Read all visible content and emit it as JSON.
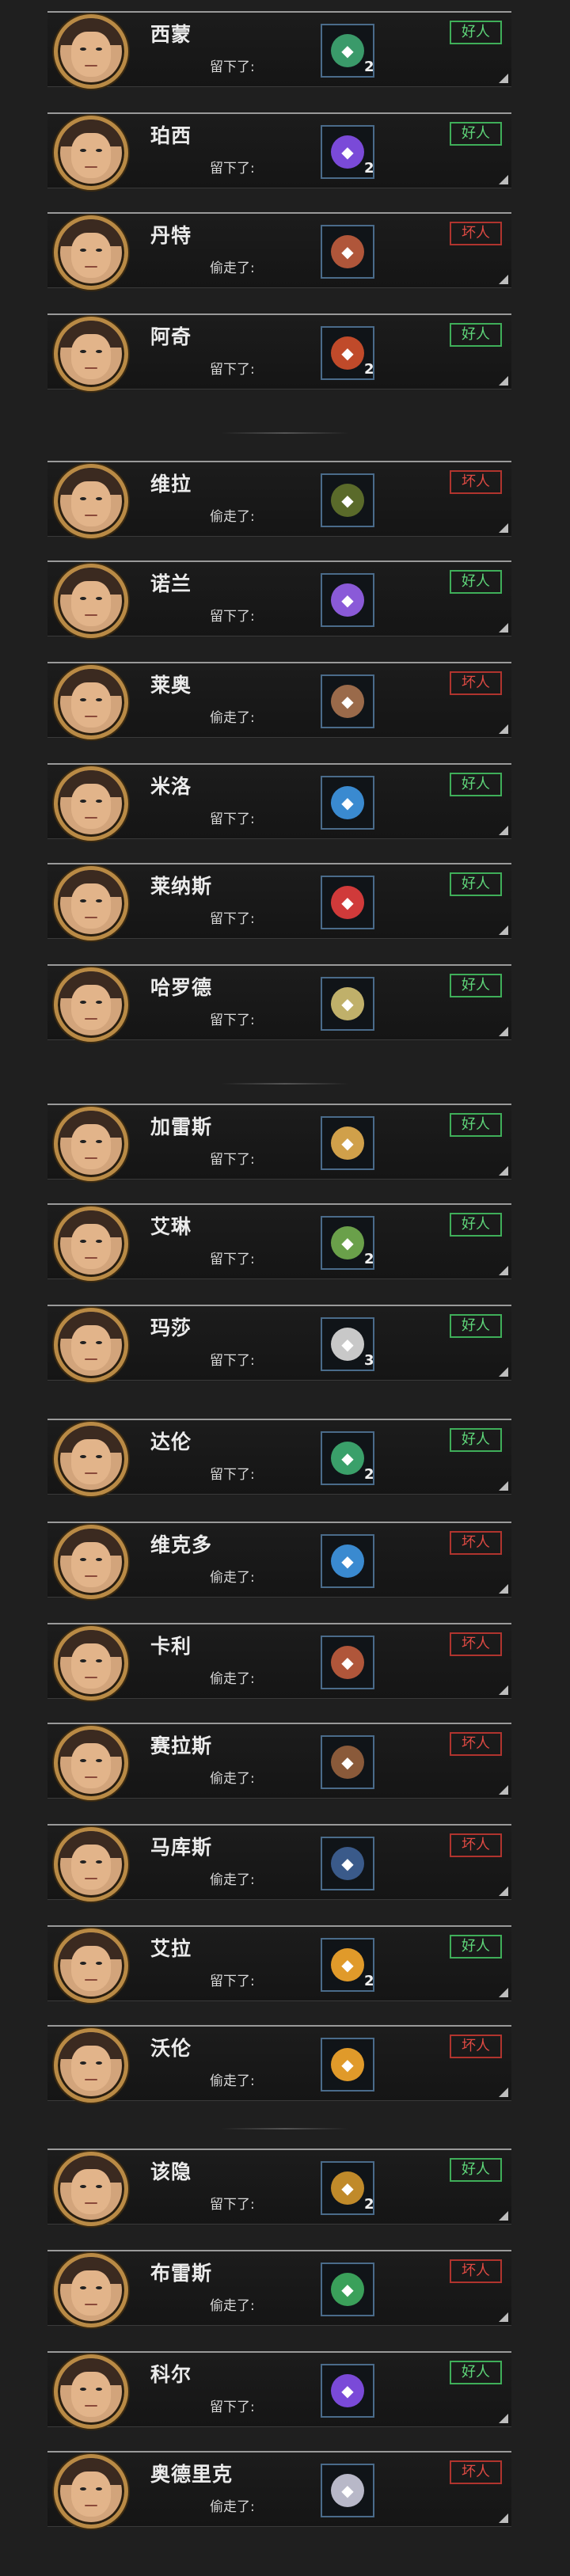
{
  "labels": {
    "left": "留下了:",
    "stole": "偷走了:",
    "good": "好人",
    "bad": "坏人"
  },
  "groups": [
    {
      "entries": [
        {
          "name": "西蒙",
          "action": "留下了:",
          "verdict": "好人",
          "good": true,
          "item_icon": "green-map-item",
          "item_color": "#3a9a6a",
          "count": "2"
        },
        {
          "name": "珀西",
          "action": "留下了:",
          "verdict": "好人",
          "good": true,
          "item_icon": "purple-tablet-item",
          "item_color": "#7a4ad8",
          "count": "2"
        },
        {
          "name": "丹特",
          "action": "偷走了:",
          "verdict": "坏人",
          "good": false,
          "item_icon": "meat-item",
          "item_color": "#b0563a",
          "count": ""
        },
        {
          "name": "阿奇",
          "action": "留下了:",
          "verdict": "好人",
          "good": true,
          "item_icon": "shotgun-shells-item",
          "item_color": "#c04a2a",
          "count": "2"
        }
      ]
    },
    {
      "entries": [
        {
          "name": "维拉",
          "action": "偷走了:",
          "verdict": "坏人",
          "good": false,
          "item_icon": "rifle-ammo-item",
          "item_color": "#5a6a2a",
          "count": ""
        },
        {
          "name": "诺兰",
          "action": "留下了:",
          "verdict": "好人",
          "good": true,
          "item_icon": "purple-bottle-item",
          "item_color": "#8a5ad8",
          "count": ""
        },
        {
          "name": "莱奥",
          "action": "偷走了:",
          "verdict": "坏人",
          "good": false,
          "item_icon": "jerky-item",
          "item_color": "#9a6a4a",
          "count": ""
        },
        {
          "name": "米洛",
          "action": "留下了:",
          "verdict": "好人",
          "good": true,
          "item_icon": "blue-battery-item",
          "item_color": "#3a8ad0",
          "count": ""
        },
        {
          "name": "莱纳斯",
          "action": "留下了:",
          "verdict": "好人",
          "good": true,
          "item_icon": "medkit-item",
          "item_color": "#d03a3a",
          "count": ""
        },
        {
          "name": "哈罗德",
          "action": "留下了:",
          "verdict": "好人",
          "good": true,
          "item_icon": "soup-bowl-item",
          "item_color": "#c0b06a",
          "count": ""
        }
      ]
    },
    {
      "entries": [
        {
          "name": "加雷斯",
          "action": "留下了:",
          "verdict": "好人",
          "good": true,
          "item_icon": "food-bowl-item",
          "item_color": "#d0a04a",
          "count": ""
        },
        {
          "name": "艾琳",
          "action": "留下了:",
          "verdict": "好人",
          "good": true,
          "item_icon": "green-map-item",
          "item_color": "#6aa04a",
          "count": "2"
        },
        {
          "name": "玛莎",
          "action": "留下了:",
          "verdict": "好人",
          "good": true,
          "item_icon": "rope-item",
          "item_color": "#c8c8c8",
          "count": "3"
        },
        {
          "name": "达伦",
          "action": "留下了:",
          "verdict": "好人",
          "good": true,
          "item_icon": "green-gear-item",
          "item_color": "#3aa06a",
          "count": "2"
        },
        {
          "name": "维克多",
          "action": "偷走了:",
          "verdict": "坏人",
          "good": false,
          "item_icon": "blue-battery-item",
          "item_color": "#3a8ad0",
          "count": ""
        },
        {
          "name": "卡利",
          "action": "偷走了:",
          "verdict": "坏人",
          "good": false,
          "item_icon": "meat-item",
          "item_color": "#b0563a",
          "count": ""
        },
        {
          "name": "赛拉斯",
          "action": "偷走了:",
          "verdict": "坏人",
          "good": false,
          "item_icon": "wood-chest-item",
          "item_color": "#8a5a3a",
          "count": ""
        },
        {
          "name": "马库斯",
          "action": "偷走了:",
          "verdict": "坏人",
          "good": false,
          "item_icon": "dark-tool-item",
          "item_color": "#3a5a8a",
          "count": ""
        },
        {
          "name": "艾拉",
          "action": "留下了:",
          "verdict": "好人",
          "good": true,
          "item_icon": "orange-bottle-item",
          "item_color": "#e09a2a",
          "count": "2"
        },
        {
          "name": "沃伦",
          "action": "偷走了:",
          "verdict": "坏人",
          "good": false,
          "item_icon": "orange-bottle-item",
          "item_color": "#e09a2a",
          "count": ""
        }
      ]
    },
    {
      "entries": [
        {
          "name": "该隐",
          "action": "留下了:",
          "verdict": "好人",
          "good": true,
          "item_icon": "ammo-bullets-item",
          "item_color": "#c08a2a",
          "count": "2"
        },
        {
          "name": "布雷斯",
          "action": "偷走了:",
          "verdict": "坏人",
          "good": false,
          "item_icon": "green-battery-item",
          "item_color": "#3aa05a",
          "count": ""
        },
        {
          "name": "科尔",
          "action": "留下了:",
          "verdict": "好人",
          "good": true,
          "item_icon": "purple-battery-item",
          "item_color": "#7a4ad8",
          "count": ""
        },
        {
          "name": "奥德里克",
          "action": "偷走了:",
          "verdict": "坏人",
          "good": false,
          "item_icon": "book-item",
          "item_color": "#b8b8c8",
          "count": ""
        }
      ]
    }
  ]
}
